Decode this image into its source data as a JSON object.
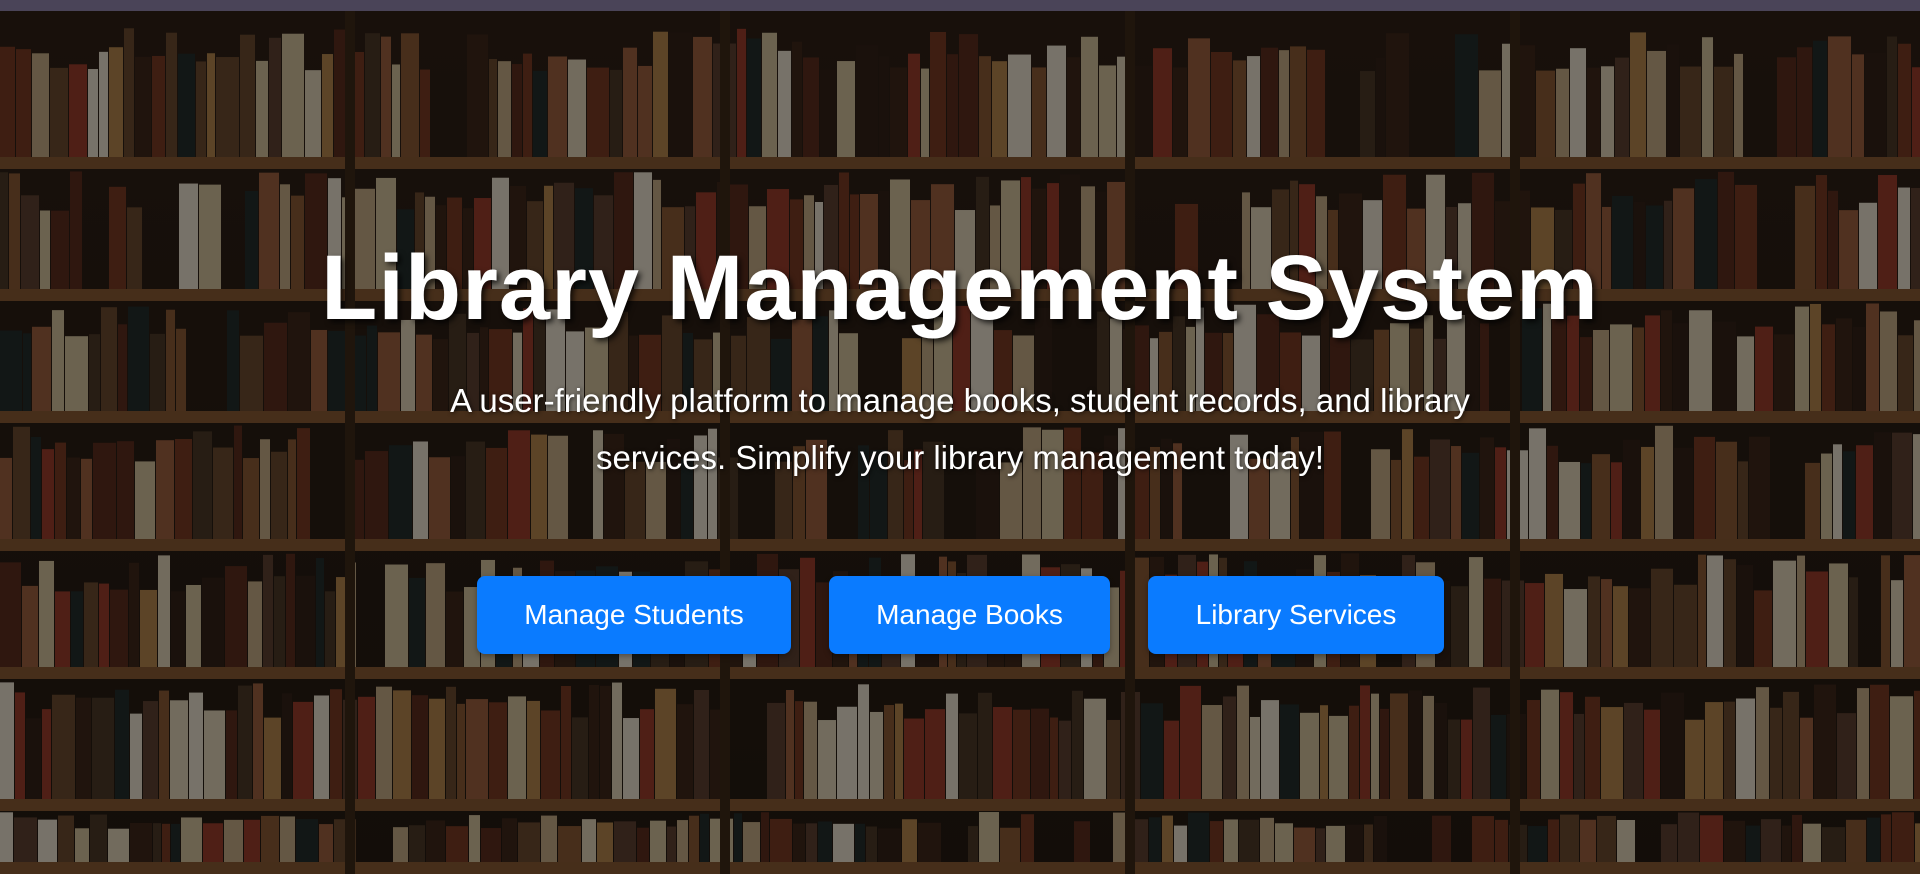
{
  "hero": {
    "title": "Library Management System",
    "subtitle": "A user-friendly platform to manage books, student records, and library services. Simplify your library management today!"
  },
  "actions": {
    "manage_students": "Manage Students",
    "manage_books": "Manage Books",
    "library_services": "Library Services"
  },
  "colors": {
    "button": "#0a7bff",
    "top_bar": "#4a4458",
    "text": "#ffffff"
  }
}
